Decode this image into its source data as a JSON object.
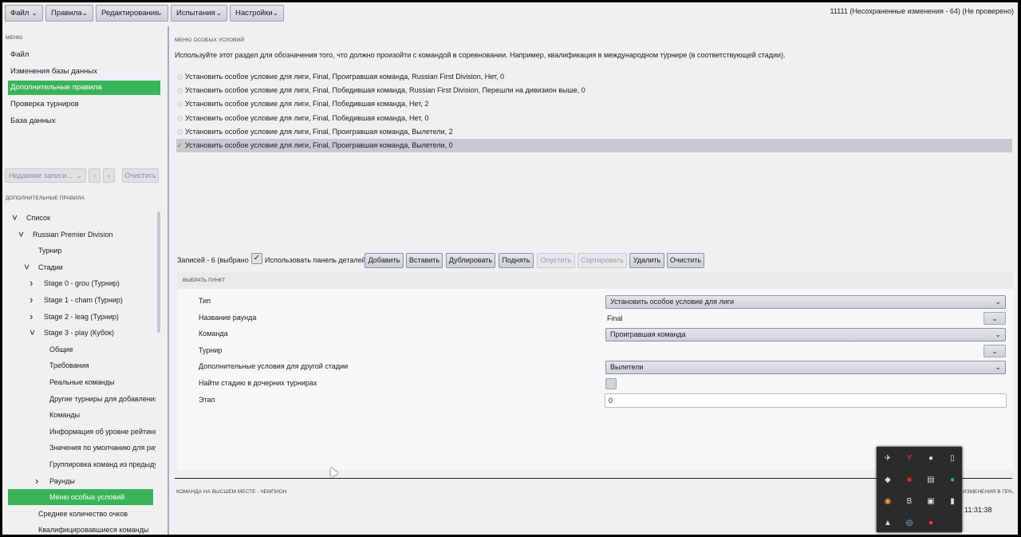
{
  "topbar": {
    "menus": [
      {
        "label": "Файл"
      },
      {
        "label": "Правила"
      },
      {
        "label": "Редактирование"
      },
      {
        "label": "Испытания"
      },
      {
        "label": "Настройки"
      }
    ],
    "status": "11111 (Несохраненные изменения - 64) (Не проверено)"
  },
  "sidebar": {
    "menu_title": "МЕНЮ",
    "menu_items": [
      {
        "label": "Файл"
      },
      {
        "label": "Изменения базы данных"
      },
      {
        "label": "Дополнительные правила"
      },
      {
        "label": "Проверка турниров"
      },
      {
        "label": "База данных"
      }
    ],
    "active_menu_index": 2,
    "recent_placeholder": "Недавние записи...",
    "clear_label": "Очистить",
    "rules_title": "ДОПОЛНИТЕЛЬНЫЕ ПРАВИЛА",
    "tree": [
      {
        "label": "Список",
        "level": 0,
        "arrow": "v"
      },
      {
        "label": "Russian Premier Division",
        "level": 1,
        "arrow": "v"
      },
      {
        "label": "Турнир",
        "level": 2,
        "arrow": ""
      },
      {
        "label": "Стадии",
        "level": 2,
        "arrow": "v"
      },
      {
        "label": "Stage 0 - grou (Турнир)",
        "level": 3,
        "arrow": ">"
      },
      {
        "label": "Stage 1 - cham (Турнир)",
        "level": 3,
        "arrow": ">"
      },
      {
        "label": "Stage 2 - leag (Турнир)",
        "level": 3,
        "arrow": ">"
      },
      {
        "label": "Stage 3 - play (Кубок)",
        "level": 3,
        "arrow": "v"
      },
      {
        "label": "Общие",
        "level": 4,
        "arrow": ""
      },
      {
        "label": "Требования",
        "level": 4,
        "arrow": ""
      },
      {
        "label": "Реальные команды",
        "level": 4,
        "arrow": ""
      },
      {
        "label": "Другие турниры для добавления ст",
        "level": 4,
        "arrow": ""
      },
      {
        "label": "Команды",
        "level": 4,
        "arrow": ""
      },
      {
        "label": "Информация об уровне рейтинга",
        "level": 4,
        "arrow": ""
      },
      {
        "label": "Значения по умолчанию для раунд",
        "level": 4,
        "arrow": ""
      },
      {
        "label": "Группировка команд из предыдущ",
        "level": 4,
        "arrow": ""
      },
      {
        "label": "Раунды",
        "level": 4,
        "arrow": ">"
      },
      {
        "label": "Меню особых условий",
        "level": 4,
        "arrow": "",
        "active": true
      },
      {
        "label": "Среднее количество очков",
        "level": 2,
        "arrow": ""
      },
      {
        "label": "Квалифицировавшиеся команды",
        "level": 2,
        "arrow": ""
      }
    ]
  },
  "main": {
    "section_title": "МЕНЮ ОСОБЫХ УСЛОВИЙ",
    "description": "Используйте этот раздел для обозначения того, что должно произойти с командой в соревновании. Например, квалификация в международном турнире (в соответствующей стадии).",
    "rules": [
      {
        "text": "Установить особое условие для лиги, Final, Проигравшая команда, Russian First Division, Нет, 0"
      },
      {
        "text": "Установить особое условие для лиги, Final, Победившая команда, Russian First Division, Перешли на дивизион выше, 0"
      },
      {
        "text": "Установить особое условие для лиги, Final, Победившая команда, Нет, 2"
      },
      {
        "text": "Установить особое условие для лиги, Final, Победившая команда, Нет, 0"
      },
      {
        "text": "Установить особое условие для лиги, Final, Проигравшая команда, Вылетели, 2"
      },
      {
        "text": "Установить особое условие для лиги, Final, Проигравшая команда, Вылетели, 0"
      }
    ],
    "selected_rule_index": 5,
    "records_label": "Записей - 6 (выбрано 1)",
    "details_label": "Использовать панель деталей",
    "actions": [
      {
        "label": "Добавить",
        "enabled": true
      },
      {
        "label": "Вставить",
        "enabled": true
      },
      {
        "label": "Дублировать",
        "enabled": true
      },
      {
        "label": "Поднять",
        "enabled": true
      },
      {
        "label": "Опустить",
        "enabled": false
      },
      {
        "label": "Сортировать",
        "enabled": false
      },
      {
        "label": "Удалить",
        "enabled": true
      },
      {
        "label": "Очистить",
        "enabled": true
      }
    ],
    "form": {
      "header": "ВЫБРАТЬ ПУНКТ",
      "type_label": "Тип",
      "type_value": "Установить особое условие для лиги",
      "round_label": "Название раунда",
      "round_value": "Final",
      "team_label": "Команда",
      "team_value": "Проигравшая команда",
      "tournament_label": "Турнир",
      "tournament_value": "",
      "extra_label": "Дополнительные условия для другой стадии",
      "extra_value": "Вылетели",
      "find_label": "Найти стадию в дочерних турнирах",
      "stage_label": "Этап",
      "stage_value": "0"
    },
    "bottom_title": "КОМАНДА НА ВЫСШЕМ МЕСТЕ - ЧЕМПИОН",
    "bottom_right_title": "ИЗМЕНЕНИЯ В ПРА...",
    "clock": "11:31:38"
  },
  "tray": {
    "icons": [
      "mouse-icon",
      "yandex-icon",
      "record-icon",
      "usb-icon",
      "drive-icon",
      "amd-icon",
      "folder-icon",
      "green-app-icon",
      "chrome-icon",
      "bold-b-icon",
      "monitor-icon",
      "battery-icon",
      "drop-icon",
      "steam-icon",
      "red-app-icon"
    ],
    "colors": {
      "yandex": "#ff3b30",
      "amd": "#e0262d",
      "green": "#2fbf50",
      "steam": "#9bc7f0"
    }
  }
}
